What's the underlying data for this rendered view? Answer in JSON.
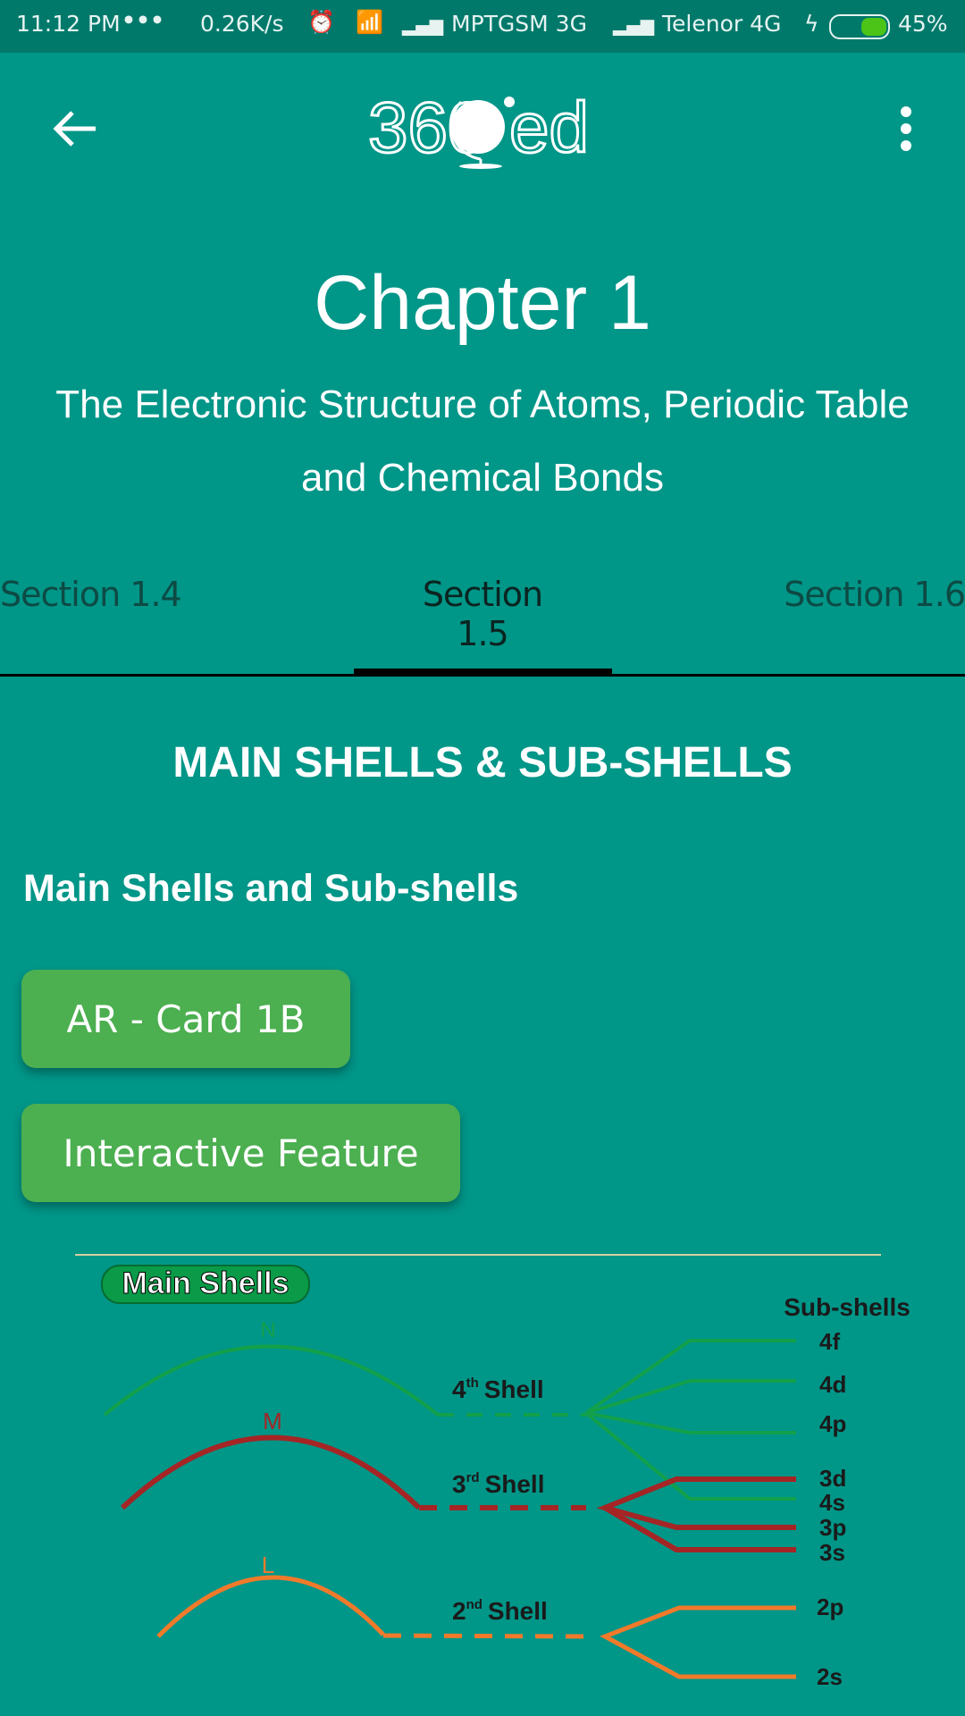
{
  "status_bar": {
    "time": "11:12 PM",
    "more": "•••",
    "speed": "0.26K/s",
    "carrier1": "MPTGSM 3G",
    "carrier2": "Telenor 4G",
    "battery": "45%",
    "battery_level": 0.45
  },
  "toolbar": {
    "logo_text_left": "360",
    "logo_text_right": "ed",
    "back_icon": "arrow-left-icon",
    "menu_icon": "more-vert-icon"
  },
  "chapter": {
    "title": "Chapter 1",
    "subtitle_line1": "The Electronic Structure of Atoms, Periodic Table",
    "subtitle_line2": "and Chemical Bonds"
  },
  "tabs": [
    {
      "label": "Section 1.4"
    },
    {
      "label": "Section 1.5",
      "active": true
    },
    {
      "label": "Section 1.6"
    }
  ],
  "content": {
    "heading": "MAIN SHELLS & SUB-SHELLS",
    "subheading": "Main Shells and Sub-shells",
    "buttons": [
      {
        "label": "AR - Card 1B"
      },
      {
        "label": "Interactive Feature"
      }
    ]
  },
  "diagram": {
    "badge": "Main Shells",
    "subshells_title": "Sub-shells",
    "shells": [
      {
        "letter": "N",
        "label": "4",
        "sup": "th",
        "word": "Shell",
        "color": "#12a04a",
        "subshells": [
          "4f",
          "4d",
          "4p",
          "4s"
        ]
      },
      {
        "letter": "M",
        "label": "3",
        "sup": "rd",
        "word": "Shell",
        "color": "#a52525",
        "subshells": [
          "3d",
          "3p",
          "3s"
        ]
      },
      {
        "letter": "L",
        "label": "2",
        "sup": "nd",
        "word": "Shell",
        "color": "#f07a2a",
        "subshells": [
          "2p",
          "2s"
        ]
      }
    ]
  },
  "colors": {
    "primary": "#009688",
    "status_bar": "#00796b",
    "button": "#4caf50"
  }
}
